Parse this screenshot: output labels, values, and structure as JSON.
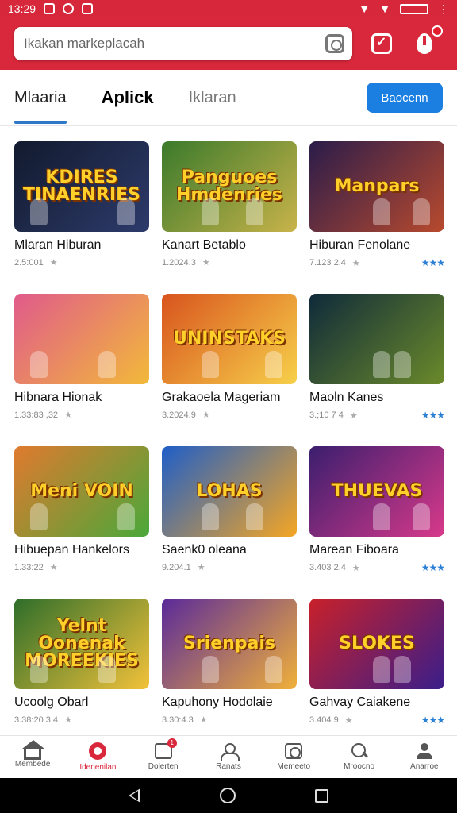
{
  "status_bar": {
    "time": "13:29",
    "battery": ""
  },
  "search": {
    "placeholder": "Ikakan markeplacah"
  },
  "tabs": [
    {
      "label": "Mlaaria",
      "active": true
    },
    {
      "label": "Aplick",
      "active": false
    },
    {
      "label": "Iklaran",
      "active": false
    }
  ],
  "primary_button": "Baocenn",
  "colors": {
    "brand_red": "#d9283b",
    "accent_blue": "#1a7fe0",
    "tab_underline": "#2e78c8"
  },
  "apps": [
    {
      "title_art": "KDIRES TINAENRIES",
      "name": "Mlaran Hiburan",
      "meta": "2.5:001",
      "rating": "",
      "bg": "linear-gradient(135deg,#121a2e,#2d3b6b)"
    },
    {
      "title_art": "Panguoes Hmdenries",
      "name": "Kanart Betablo",
      "meta": "1.2024.3",
      "rating": "",
      "bg": "linear-gradient(135deg,#3a7a2b,#c8b34a)"
    },
    {
      "title_art": "Manpars",
      "name": "Hiburan Fenolane",
      "meta": "7.123 2.4",
      "rating": "★★★",
      "bg": "linear-gradient(135deg,#2a1c4a,#b84a2e)"
    },
    {
      "title_art": "",
      "name": "Hibnara Hionak",
      "meta": "1.33:83 ,32",
      "rating": "",
      "bg": "linear-gradient(135deg,#e05a8b,#f2b93a)"
    },
    {
      "title_art": "UNINSTAKS",
      "name": "Grakaoela Mageriam",
      "meta": "3.2024.9",
      "rating": "",
      "bg": "linear-gradient(135deg,#d8541e,#f7d04a)"
    },
    {
      "title_art": "",
      "name": "Maoln Kanes",
      "meta": "3.;10 7 4",
      "rating": "★★★",
      "bg": "linear-gradient(135deg,#0f2a3a,#6b8a2a)"
    },
    {
      "title_art": "Meni VOIN",
      "name": "Hibuepan Hankelors",
      "meta": "1.33:22",
      "rating": "",
      "bg": "linear-gradient(135deg,#e07a2e,#4aa83a)"
    },
    {
      "title_art": "LOHAS",
      "name": "Saenk0 oleana",
      "meta": "9.204.1",
      "rating": "",
      "bg": "linear-gradient(135deg,#1e5ec8,#f5a623)"
    },
    {
      "title_art": "THUEVAS",
      "name": "Marean Fiboara",
      "meta": "3.403 2.4",
      "rating": "★★★",
      "bg": "linear-gradient(135deg,#3b1e6e,#d8398a)"
    },
    {
      "title_art": "Yelnt Oonenak MOREEKIES",
      "name": "Ucoolg Obarl",
      "meta": "3.38:20 3.4",
      "rating": "",
      "bg": "linear-gradient(135deg,#2e6e2a,#f2c23a)"
    },
    {
      "title_art": "Srienpais",
      "name": "Kapuhony Hodolaie",
      "meta": "3.30:4.3",
      "rating": "",
      "bg": "linear-gradient(135deg,#5a2a9a,#f0b03a)"
    },
    {
      "title_art": "SLOKES",
      "name": "Gahvay Caiakene",
      "meta": "3.404 9",
      "rating": "★★★",
      "bg": "linear-gradient(135deg,#c8202a,#3a1e8a)"
    }
  ],
  "bottom_nav": [
    {
      "label": "Membede",
      "icon": "home-icon",
      "active": false
    },
    {
      "label": "Idenenilan",
      "icon": "disc-icon",
      "active": true
    },
    {
      "label": "Dolerten",
      "icon": "document-icon",
      "active": false,
      "badge": "1"
    },
    {
      "label": "Ranats",
      "icon": "user-icon",
      "active": false
    },
    {
      "label": "Memeeto",
      "icon": "image-frame-icon",
      "active": false
    },
    {
      "label": "Mroocno",
      "icon": "search-icon",
      "active": false
    },
    {
      "label": "Anarroe",
      "icon": "profile-icon",
      "active": false
    }
  ]
}
